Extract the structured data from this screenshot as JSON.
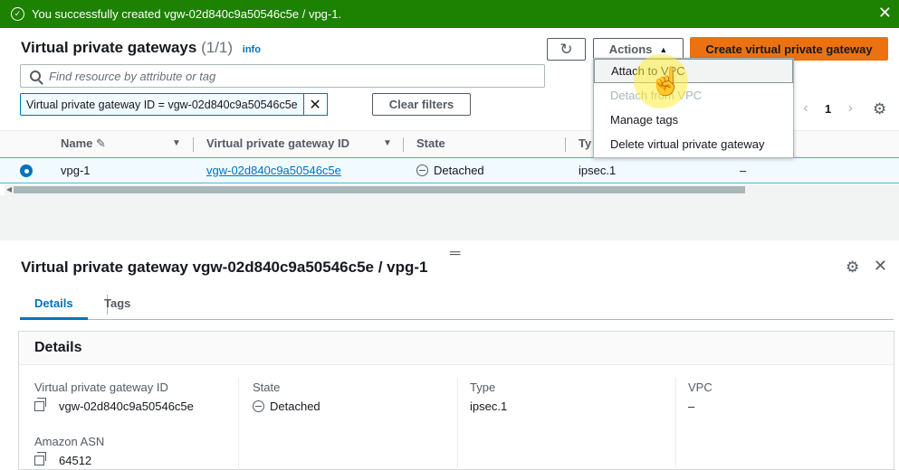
{
  "flash": {
    "message": "You successfully created vgw-02d840c9a50546c5e / vpg-1.",
    "close_glyph": "✕",
    "color": "#1d8102"
  },
  "list": {
    "title": "Virtual private gateways",
    "count": "(1/1)",
    "info": "info",
    "refresh_glyph": "↻",
    "actions_label": "Actions",
    "create_label": "Create virtual private gateway",
    "search_placeholder": "Find resource by attribute or tag",
    "filter_token": "Virtual private gateway ID = vgw-02d840c9a50546c5e",
    "clear_filters": "Clear filters",
    "page": "1",
    "columns": {
      "name": "Name",
      "vgw_id": "Virtual private gateway ID",
      "state": "State",
      "type": "Ty"
    },
    "rows": [
      {
        "name": "vpg-1",
        "vgw_id": "vgw-02d840c9a50546c5e",
        "state": "Detached",
        "type": "ipsec.1",
        "vpc": "–"
      }
    ]
  },
  "actions_menu": {
    "items": [
      {
        "label": "Attach to VPC",
        "state": "hover"
      },
      {
        "label": "Detach from VPC",
        "state": "disabled"
      },
      {
        "label": "Manage tags",
        "state": "normal"
      },
      {
        "label": "Delete virtual private gateway",
        "state": "normal"
      }
    ]
  },
  "detail": {
    "title": "Virtual private gateway vgw-02d840c9a50546c5e / vpg-1",
    "tabs": [
      "Details",
      "Tags"
    ],
    "section": "Details",
    "fields": {
      "vgw_id_label": "Virtual private gateway ID",
      "vgw_id": "vgw-02d840c9a50546c5e",
      "state_label": "State",
      "state": "Detached",
      "type_label": "Type",
      "type": "ipsec.1",
      "vpc_label": "VPC",
      "vpc": "–",
      "asn_label": "Amazon ASN",
      "asn": "64512"
    }
  },
  "colors": {
    "primary_button": "#ec7211",
    "link": "#0073bb",
    "selected_row": "#f1faff"
  }
}
